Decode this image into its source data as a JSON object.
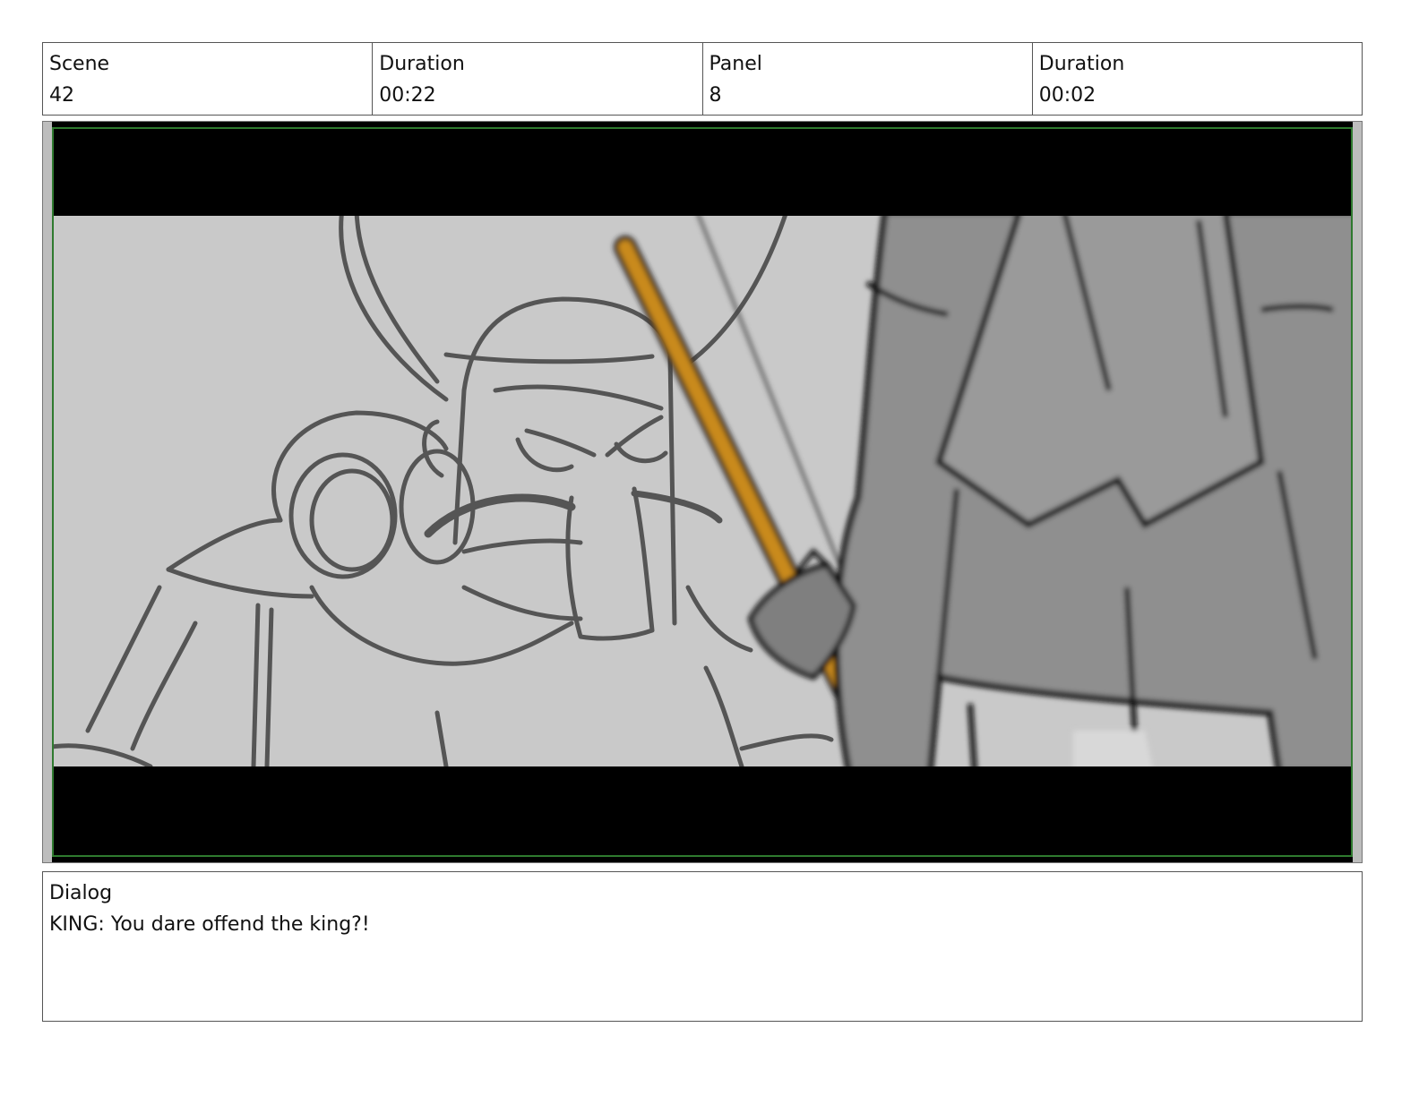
{
  "header": {
    "cells": [
      {
        "label": "Scene",
        "value": "42"
      },
      {
        "label": "Duration",
        "value": "00:22"
      },
      {
        "label": "Panel",
        "value": "8"
      },
      {
        "label": "Duration",
        "value": "00:02"
      }
    ]
  },
  "panel": {
    "colors": {
      "letterbox": "#000000",
      "safe_frame": "#2f7a2f",
      "background": "#c9c9c9",
      "sketch_line": "#555555",
      "staff": "#c98a1e",
      "cloak": "#8c8c8c"
    }
  },
  "dialog": {
    "label": "Dialog",
    "text": "KING: You dare offend the king?!"
  }
}
